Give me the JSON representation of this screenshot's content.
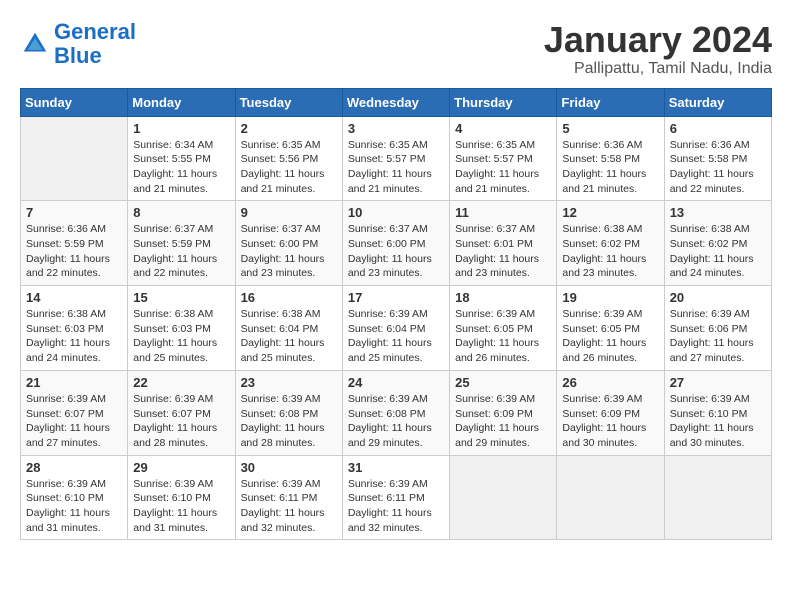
{
  "logo": {
    "line1": "General",
    "line2": "Blue"
  },
  "title": "January 2024",
  "location": "Pallipattu, Tamil Nadu, India",
  "days_header": [
    "Sunday",
    "Monday",
    "Tuesday",
    "Wednesday",
    "Thursday",
    "Friday",
    "Saturday"
  ],
  "weeks": [
    [
      {
        "num": "",
        "sunrise": "",
        "sunset": "",
        "daylight": ""
      },
      {
        "num": "1",
        "sunrise": "Sunrise: 6:34 AM",
        "sunset": "Sunset: 5:55 PM",
        "daylight": "Daylight: 11 hours and 21 minutes."
      },
      {
        "num": "2",
        "sunrise": "Sunrise: 6:35 AM",
        "sunset": "Sunset: 5:56 PM",
        "daylight": "Daylight: 11 hours and 21 minutes."
      },
      {
        "num": "3",
        "sunrise": "Sunrise: 6:35 AM",
        "sunset": "Sunset: 5:57 PM",
        "daylight": "Daylight: 11 hours and 21 minutes."
      },
      {
        "num": "4",
        "sunrise": "Sunrise: 6:35 AM",
        "sunset": "Sunset: 5:57 PM",
        "daylight": "Daylight: 11 hours and 21 minutes."
      },
      {
        "num": "5",
        "sunrise": "Sunrise: 6:36 AM",
        "sunset": "Sunset: 5:58 PM",
        "daylight": "Daylight: 11 hours and 21 minutes."
      },
      {
        "num": "6",
        "sunrise": "Sunrise: 6:36 AM",
        "sunset": "Sunset: 5:58 PM",
        "daylight": "Daylight: 11 hours and 22 minutes."
      }
    ],
    [
      {
        "num": "7",
        "sunrise": "Sunrise: 6:36 AM",
        "sunset": "Sunset: 5:59 PM",
        "daylight": "Daylight: 11 hours and 22 minutes."
      },
      {
        "num": "8",
        "sunrise": "Sunrise: 6:37 AM",
        "sunset": "Sunset: 5:59 PM",
        "daylight": "Daylight: 11 hours and 22 minutes."
      },
      {
        "num": "9",
        "sunrise": "Sunrise: 6:37 AM",
        "sunset": "Sunset: 6:00 PM",
        "daylight": "Daylight: 11 hours and 23 minutes."
      },
      {
        "num": "10",
        "sunrise": "Sunrise: 6:37 AM",
        "sunset": "Sunset: 6:00 PM",
        "daylight": "Daylight: 11 hours and 23 minutes."
      },
      {
        "num": "11",
        "sunrise": "Sunrise: 6:37 AM",
        "sunset": "Sunset: 6:01 PM",
        "daylight": "Daylight: 11 hours and 23 minutes."
      },
      {
        "num": "12",
        "sunrise": "Sunrise: 6:38 AM",
        "sunset": "Sunset: 6:02 PM",
        "daylight": "Daylight: 11 hours and 23 minutes."
      },
      {
        "num": "13",
        "sunrise": "Sunrise: 6:38 AM",
        "sunset": "Sunset: 6:02 PM",
        "daylight": "Daylight: 11 hours and 24 minutes."
      }
    ],
    [
      {
        "num": "14",
        "sunrise": "Sunrise: 6:38 AM",
        "sunset": "Sunset: 6:03 PM",
        "daylight": "Daylight: 11 hours and 24 minutes."
      },
      {
        "num": "15",
        "sunrise": "Sunrise: 6:38 AM",
        "sunset": "Sunset: 6:03 PM",
        "daylight": "Daylight: 11 hours and 25 minutes."
      },
      {
        "num": "16",
        "sunrise": "Sunrise: 6:38 AM",
        "sunset": "Sunset: 6:04 PM",
        "daylight": "Daylight: 11 hours and 25 minutes."
      },
      {
        "num": "17",
        "sunrise": "Sunrise: 6:39 AM",
        "sunset": "Sunset: 6:04 PM",
        "daylight": "Daylight: 11 hours and 25 minutes."
      },
      {
        "num": "18",
        "sunrise": "Sunrise: 6:39 AM",
        "sunset": "Sunset: 6:05 PM",
        "daylight": "Daylight: 11 hours and 26 minutes."
      },
      {
        "num": "19",
        "sunrise": "Sunrise: 6:39 AM",
        "sunset": "Sunset: 6:05 PM",
        "daylight": "Daylight: 11 hours and 26 minutes."
      },
      {
        "num": "20",
        "sunrise": "Sunrise: 6:39 AM",
        "sunset": "Sunset: 6:06 PM",
        "daylight": "Daylight: 11 hours and 27 minutes."
      }
    ],
    [
      {
        "num": "21",
        "sunrise": "Sunrise: 6:39 AM",
        "sunset": "Sunset: 6:07 PM",
        "daylight": "Daylight: 11 hours and 27 minutes."
      },
      {
        "num": "22",
        "sunrise": "Sunrise: 6:39 AM",
        "sunset": "Sunset: 6:07 PM",
        "daylight": "Daylight: 11 hours and 28 minutes."
      },
      {
        "num": "23",
        "sunrise": "Sunrise: 6:39 AM",
        "sunset": "Sunset: 6:08 PM",
        "daylight": "Daylight: 11 hours and 28 minutes."
      },
      {
        "num": "24",
        "sunrise": "Sunrise: 6:39 AM",
        "sunset": "Sunset: 6:08 PM",
        "daylight": "Daylight: 11 hours and 29 minutes."
      },
      {
        "num": "25",
        "sunrise": "Sunrise: 6:39 AM",
        "sunset": "Sunset: 6:09 PM",
        "daylight": "Daylight: 11 hours and 29 minutes."
      },
      {
        "num": "26",
        "sunrise": "Sunrise: 6:39 AM",
        "sunset": "Sunset: 6:09 PM",
        "daylight": "Daylight: 11 hours and 30 minutes."
      },
      {
        "num": "27",
        "sunrise": "Sunrise: 6:39 AM",
        "sunset": "Sunset: 6:10 PM",
        "daylight": "Daylight: 11 hours and 30 minutes."
      }
    ],
    [
      {
        "num": "28",
        "sunrise": "Sunrise: 6:39 AM",
        "sunset": "Sunset: 6:10 PM",
        "daylight": "Daylight: 11 hours and 31 minutes."
      },
      {
        "num": "29",
        "sunrise": "Sunrise: 6:39 AM",
        "sunset": "Sunset: 6:10 PM",
        "daylight": "Daylight: 11 hours and 31 minutes."
      },
      {
        "num": "30",
        "sunrise": "Sunrise: 6:39 AM",
        "sunset": "Sunset: 6:11 PM",
        "daylight": "Daylight: 11 hours and 32 minutes."
      },
      {
        "num": "31",
        "sunrise": "Sunrise: 6:39 AM",
        "sunset": "Sunset: 6:11 PM",
        "daylight": "Daylight: 11 hours and 32 minutes."
      },
      {
        "num": "",
        "sunrise": "",
        "sunset": "",
        "daylight": ""
      },
      {
        "num": "",
        "sunrise": "",
        "sunset": "",
        "daylight": ""
      },
      {
        "num": "",
        "sunrise": "",
        "sunset": "",
        "daylight": ""
      }
    ]
  ]
}
